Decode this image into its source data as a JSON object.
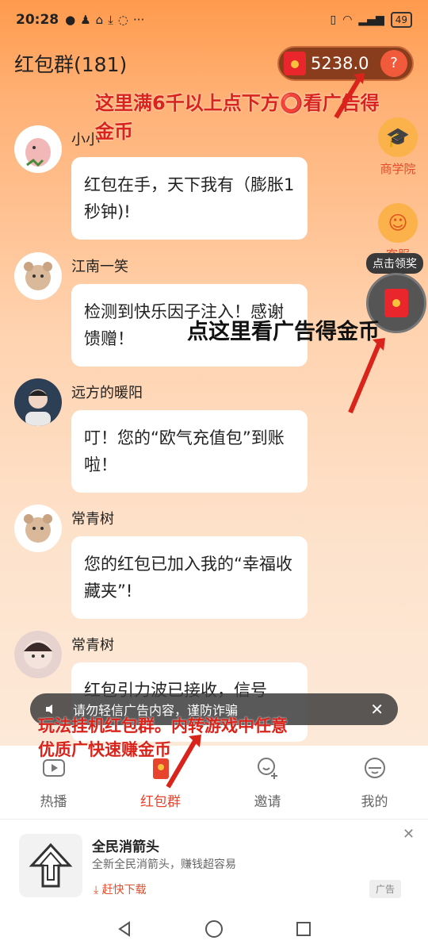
{
  "status_bar": {
    "time": "20:28",
    "icons": [
      "app-icon",
      "penguin-icon",
      "home-icon",
      "download-icon",
      "chat-icon"
    ],
    "more": "···",
    "battery": "49"
  },
  "header": {
    "title": "红包群(181)",
    "coins": "5238.0",
    "help": "?"
  },
  "side": {
    "school_label": "商学院",
    "service_label": "客服",
    "claim_tag": "点击领奖"
  },
  "messages": [
    {
      "sender": "小小",
      "text": "红包在手，天下我有（膨胀1秒钟)!"
    },
    {
      "sender": "江南一笑",
      "text": "检测到快乐因子注入！感谢馈赠！"
    },
    {
      "sender": "远方的暖阳",
      "text": "叮！您的“欧气充值包”到账啦！"
    },
    {
      "sender": "常青树",
      "text": "您的红包已加入我的“幸福收藏夹”!"
    },
    {
      "sender": "常青树",
      "text": "红包引力波已接收，信号"
    }
  ],
  "toast": {
    "text": "请勿轻信广告内容，谨防诈骗",
    "close": "✕"
  },
  "nav": [
    {
      "label": "热播",
      "icon": "play-icon"
    },
    {
      "label": "红包群",
      "icon": "redpacket-icon"
    },
    {
      "label": "邀请",
      "icon": "invite-icon"
    },
    {
      "label": "我的",
      "icon": "profile-icon"
    }
  ],
  "ad": {
    "title": "全民消箭头",
    "subtitle": "全新全民消箭头，赚钱超容易",
    "cta": "赶快下载",
    "tag": "广告",
    "close": "✕"
  },
  "annotations": {
    "top": "这里满6千以上点下方⭕看广告得金币",
    "middle": "点这里看广告得金币",
    "bottom": "玩法挂机红包群。内转游戏中任意优质广快速赚金币"
  },
  "colors": {
    "accent": "#e8432c",
    "annotation": "#d9241b",
    "coin_pill": "#8a3d1c"
  }
}
